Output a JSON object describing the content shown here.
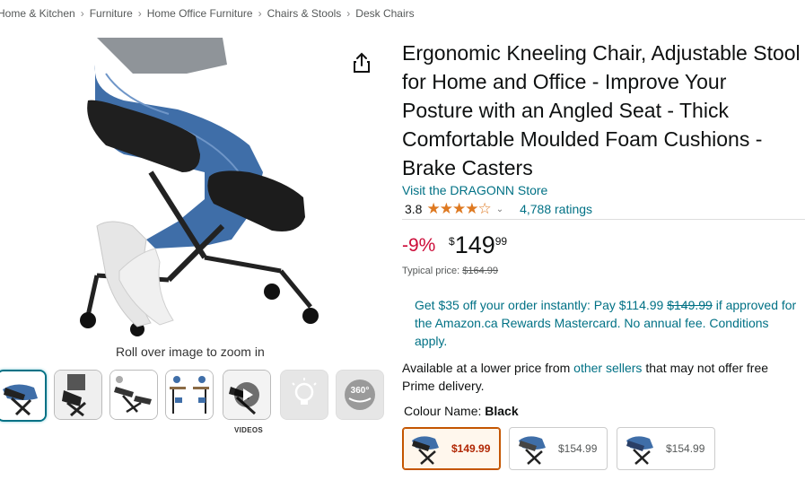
{
  "breadcrumb": {
    "items": [
      "Home & Kitchen",
      "Furniture",
      "Home Office Furniture",
      "Chairs & Stools",
      "Desk Chairs"
    ],
    "separator": "›"
  },
  "gallery": {
    "zoom_hint": "Roll over image to zoom in",
    "videos_label": "VIDEOS",
    "thumbnails": [
      "chair-side-view",
      "chair-with-person",
      "chair-features",
      "chair-desk-setup",
      "video-play",
      "lightbulb-icon",
      "360-view-icon"
    ]
  },
  "product": {
    "title": "Ergonomic Kneeling Chair, Adjustable Stool for Home and Office - Improve Your Posture with an Angled Seat - Thick Comfortable Moulded Foam Cushions - Brake Casters",
    "store_link": "Visit the DRAGONN Store",
    "rating": "3.8",
    "stars_filled": 3.8,
    "ratings_count": "4,788 ratings",
    "discount": "-9%",
    "price_symbol": "$",
    "price_whole": "149",
    "price_fraction": "99",
    "typical_label": "Typical price:",
    "typical_price": "$164.99",
    "promo_part1": "Get $35 off your order instantly: Pay $114.99",
    "promo_strike": "$149.99",
    "promo_part2": "if approved for the Amazon.ca Rewards Mastercard. No annual fee. Conditions apply.",
    "other_pre": "Available at a lower price from",
    "other_link": "other sellers",
    "other_post": "that may not offer free Prime delivery.",
    "colour_label": "Colour Name:",
    "colour_value": "Black",
    "swatches": [
      {
        "price": "$149.99",
        "selected": true
      },
      {
        "price": "$154.99",
        "selected": false
      },
      {
        "price": "$154.99",
        "selected": false
      }
    ]
  },
  "colors": {
    "link": "#007185",
    "deal_red": "#cc0c39",
    "star": "#de7921",
    "selected_border": "#c45500"
  }
}
